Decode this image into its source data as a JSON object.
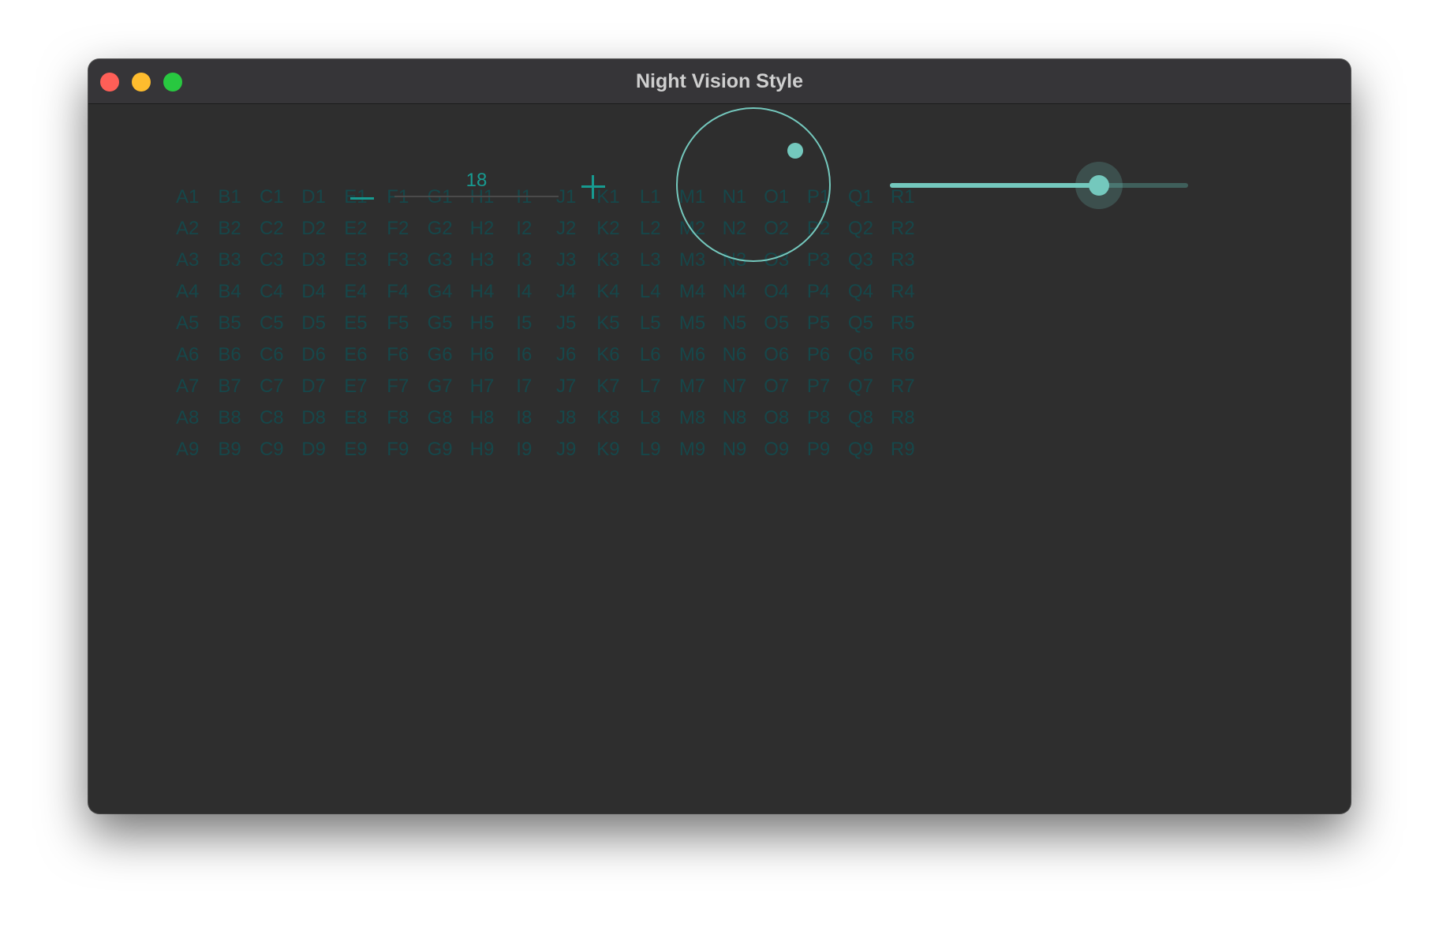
{
  "window": {
    "title": "Night Vision Style"
  },
  "grid": {
    "columns": [
      "A",
      "B",
      "C",
      "D",
      "E",
      "F",
      "G",
      "H",
      "I",
      "J",
      "K",
      "L",
      "M",
      "N",
      "O",
      "P",
      "Q",
      "R"
    ],
    "rows": [
      "1",
      "2",
      "3",
      "4",
      "5",
      "6",
      "7",
      "8",
      "9"
    ]
  },
  "stepper": {
    "value": "18",
    "minus_icon": "minus-icon",
    "plus_icon": "plus-icon"
  },
  "knob": {
    "indicator_angle_deg": 40
  },
  "slider": {
    "value": 0.7
  },
  "colors": {
    "background": "#2e2e2e",
    "titlebar": "#363538",
    "accent": "#74c8bd",
    "stepper_accent": "#179a90",
    "grid_text": "#16474a"
  }
}
